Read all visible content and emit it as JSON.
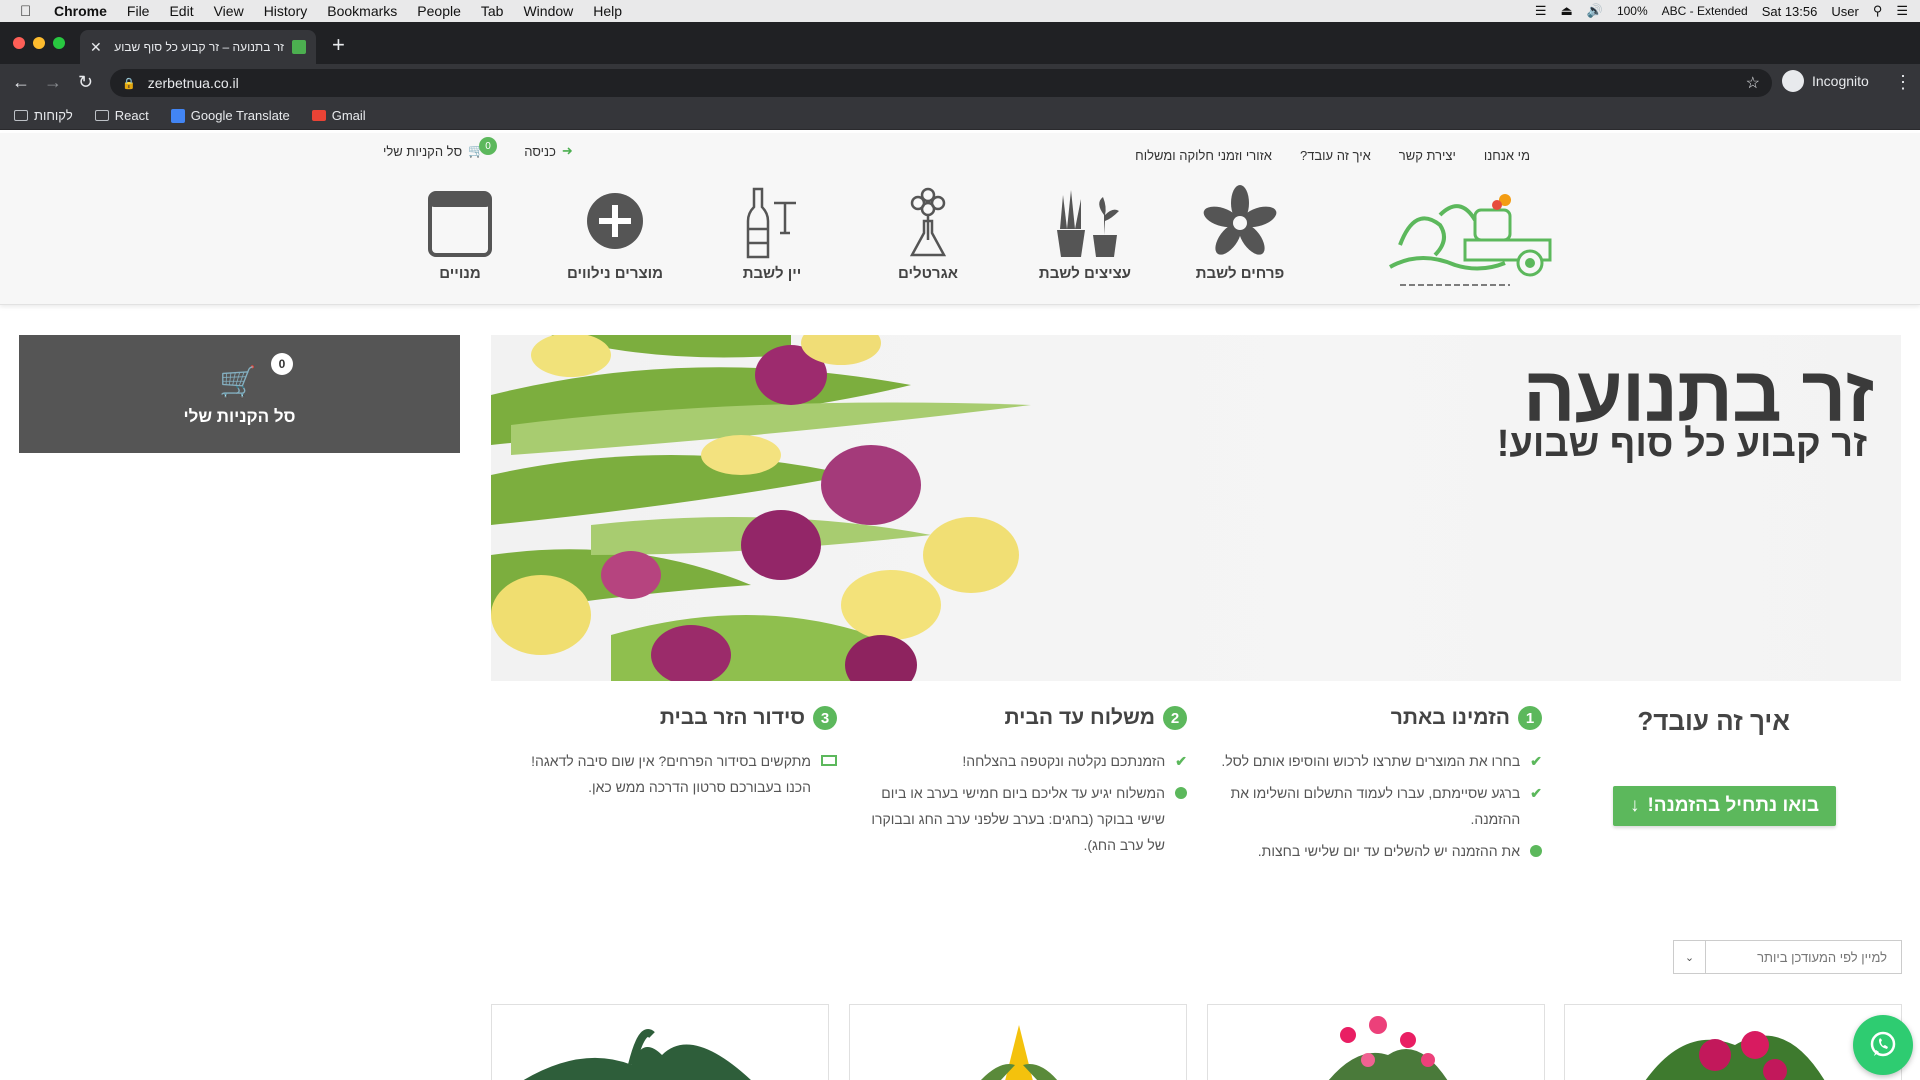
{
  "menubar": {
    "app": "Chrome",
    "items": [
      "File",
      "Edit",
      "View",
      "History",
      "Bookmarks",
      "People",
      "Tab",
      "Window",
      "Help"
    ],
    "battery": "100%",
    "input_source": "ABC - Extended",
    "clock": "Sat 13:56",
    "user": "User"
  },
  "browser": {
    "tab_title": "זר בתנועה – זר קבוע כל סוף שבוע",
    "url": "zerbetnua.co.il",
    "profile": "Incognito"
  },
  "bookmarks": [
    {
      "label": "לקוחות",
      "icon": "folder-icon"
    },
    {
      "label": "React",
      "icon": "folder-icon"
    },
    {
      "label": "Google Translate",
      "icon": "translate-icon"
    },
    {
      "label": "Gmail",
      "icon": "gmail-icon"
    }
  ],
  "site": {
    "topnav": [
      "מי אנחנו",
      "יצירת קשר",
      "איך זה עובד?",
      "אזורי וזמני חלוקה ומשלוח"
    ],
    "login": "כניסה",
    "cart_label": "סל הקניות שלי",
    "cart_count": "0",
    "categories": [
      {
        "label": "פרחים לשבת",
        "icon": "flower-icon"
      },
      {
        "label": "עציצים לשבת",
        "icon": "potted-plants-icon"
      },
      {
        "label": "אגרטלים",
        "icon": "vase-icon"
      },
      {
        "label": "יין לשבת",
        "icon": "wine-icon"
      },
      {
        "label": "מוצרים נילווים",
        "icon": "plus-circle-icon"
      },
      {
        "label": "מנויים",
        "icon": "calendar-icon"
      }
    ],
    "cart_widget": {
      "count": "0",
      "label": "סל הקניות שלי"
    },
    "hero": {
      "title": "זר בתנועה",
      "subtitle": "זר קבוע כל סוף שבוע!"
    },
    "how": {
      "title": "איך זה עובד?",
      "cta": "בואו נתחיל בהזמנה!",
      "steps": [
        {
          "num": "1",
          "title": "הזמינו באתר",
          "items": [
            "בחרו את המוצרים שתרצו לרכוש והוסיפו אותם לסל.",
            "ברגע שסיימתם, עברו לעמוד התשלום והשלימו את ההזמנה.",
            "את ההזמנה יש להשלים עד יום שלישי בחצות."
          ]
        },
        {
          "num": "2",
          "title": "משלוח עד הבית",
          "items": [
            "הזמנתכם נקלטה ונקטפה בהצלחה!",
            "המשלוח יגיע עד אליכם ביום חמישי בערב או ביום שישי בבוקר (בחגים: בערב שלפני ערב החג ובבוקרו של ערב החג)."
          ]
        },
        {
          "num": "3",
          "title": "סידור הזר בבית",
          "items": [
            "מתקשים בסידור הפרחים? אין שום סיבה לדאגה! הכנו בעבורכם סרטון הדרכה ממש כאן."
          ]
        }
      ]
    },
    "sort_select": "למיין לפי המעודכן ביותר"
  },
  "colors": {
    "accent": "#5cb85c",
    "dark_panel": "#555555"
  }
}
